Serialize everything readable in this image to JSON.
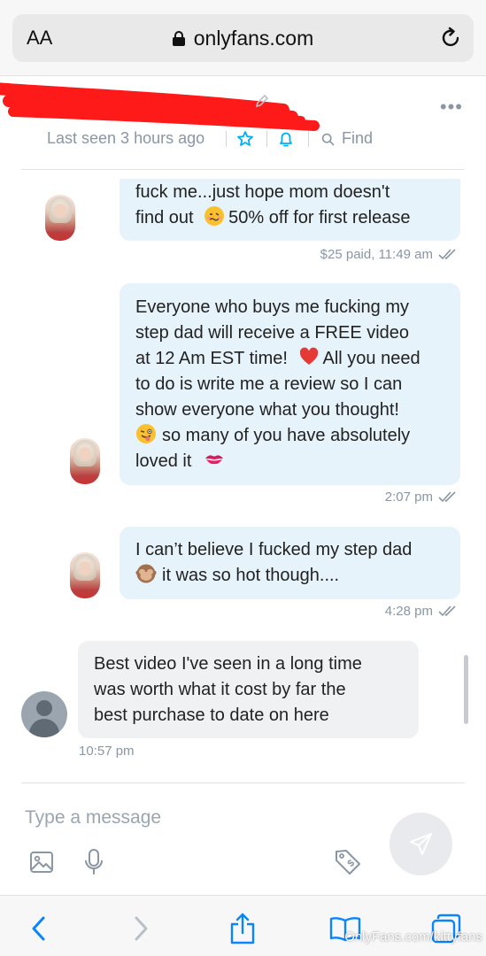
{
  "browser": {
    "text_size_label": "AA",
    "domain": "onlyfans.com"
  },
  "chat_header": {
    "last_seen": "Last seen 3 hours ago",
    "find_label": "Find"
  },
  "messages": [
    {
      "direction": "out",
      "lines": [
        "fuck me...just hope mom doesn't",
        "find out",
        "50% off for first release"
      ],
      "meta": "$25 paid, 11:49 am"
    },
    {
      "direction": "out",
      "lines": [
        "Everyone who buys me fucking my",
        "step dad will receive a FREE video",
        "at 12 Am EST time!",
        "All you need",
        "to do is write me a review so I can",
        "show everyone what you thought!",
        "so many of you have absolutely",
        "loved it"
      ],
      "meta": "2:07 pm"
    },
    {
      "direction": "out",
      "lines": [
        "I can’t believe I fucked my step dad",
        "it was so hot though...."
      ],
      "meta": "4:28 pm"
    },
    {
      "direction": "in",
      "lines": [
        "Best video I've seen in a long time",
        "was worth what it cost by far the",
        "best purchase to date on here"
      ],
      "meta": "10:57 pm"
    }
  ],
  "composer": {
    "placeholder": "Type a message"
  },
  "watermark": "OnlyFans.com/kittyfans",
  "colors": {
    "accent": "#00aff0",
    "outgoing_bubble": "#e6f3fb",
    "incoming_bubble": "#f0f1f3",
    "muted_text": "#8a96a3",
    "redaction": "#ff1a1a"
  },
  "icons": [
    "lock-icon",
    "reload-icon",
    "pencil-icon",
    "more-options-icon",
    "star-icon",
    "bell-icon",
    "search-icon",
    "double-check-icon",
    "image-icon",
    "microphone-icon",
    "price-tag-icon",
    "send-icon",
    "back-icon",
    "forward-icon",
    "share-icon",
    "bookmarks-icon",
    "tabs-icon"
  ]
}
